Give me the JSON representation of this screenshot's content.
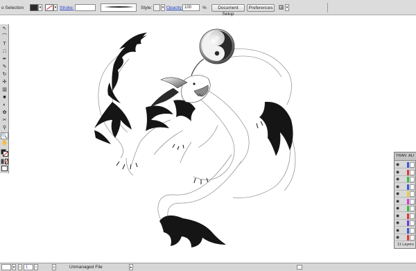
{
  "control_bar": {
    "selection_label": "o Selection",
    "stroke_label": "Stroke:",
    "style_label": "Style:",
    "opacity_label": "Opacity:",
    "opacity_value": "100",
    "opacity_unit": "%",
    "document_setup_button": "Document Setup",
    "preferences_button": "Preferences"
  },
  "layers_panel": {
    "tab_transform": "TRAN",
    "tab_align": "ALI",
    "layer_count": "11 Layers",
    "layer_colors": [
      "#3b5bd6",
      "#e03838",
      "#3bb84a",
      "#3b5bd6",
      "#e2d33a",
      "#d63bd6",
      "#3bb84a",
      "#e03838",
      "#6a3bd6",
      "#3b5bd6",
      "#e03838"
    ]
  },
  "status_bar": {
    "zoom_value": "",
    "page_value": "1",
    "status_text": "Unmanaged File"
  },
  "colors": {
    "panel_bg": "#d6d6d6",
    "accent_blue": "#2a48c8"
  }
}
